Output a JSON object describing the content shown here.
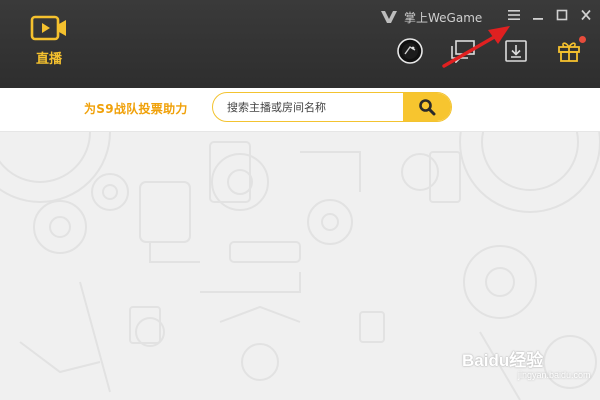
{
  "titlebar": {
    "live_tab_label": "直播",
    "brand_text": "掌上WeGame",
    "colors": {
      "accent": "#f5c12e",
      "background": "#333333"
    }
  },
  "window_controls": [
    "menu-icon",
    "minimize-icon",
    "maximize-icon",
    "close-icon"
  ],
  "toolbar": {
    "icons": [
      "avatar-icon",
      "message-icon",
      "download-icon",
      "gift-icon"
    ],
    "gift_has_notification": true
  },
  "searchbar": {
    "promo_text": "为S9战队投票助力",
    "search_placeholder": "搜索主播或房间名称",
    "search_value": "",
    "colors": {
      "border": "#f3c330",
      "button": "#f7c52f",
      "promo": "#f0a10a"
    }
  },
  "annotation": {
    "color": "#e02020"
  },
  "watermark": {
    "text": "Baidu经验",
    "sub": "jingyan.baidu.com"
  }
}
